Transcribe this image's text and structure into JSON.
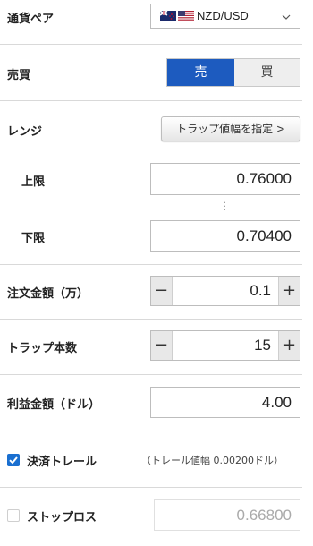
{
  "pair": {
    "label": "通貨ペア",
    "value": "NZD/USD"
  },
  "side": {
    "label": "売買",
    "sell": "売",
    "buy": "買",
    "selected": "sell"
  },
  "range": {
    "label": "レンジ",
    "button": "トラップ値幅を指定 >"
  },
  "upper": {
    "label": "上限",
    "value": "0.76000"
  },
  "lower": {
    "label": "下限",
    "value": "0.70400"
  },
  "amount": {
    "label": "注文金額（万）",
    "value": "0.1"
  },
  "traps": {
    "label": "トラップ本数",
    "value": "15"
  },
  "profit": {
    "label": "利益金額（ドル）",
    "value": "4.00"
  },
  "trail": {
    "label": "決済トレール",
    "note": "（トレール値幅 0.00200ドル）",
    "checked": true
  },
  "stoploss": {
    "label": "ストップロス",
    "placeholder": "0.66800",
    "checked": false
  },
  "colors": {
    "accent": "#1d5bbf",
    "check": "#1a6fd0"
  }
}
